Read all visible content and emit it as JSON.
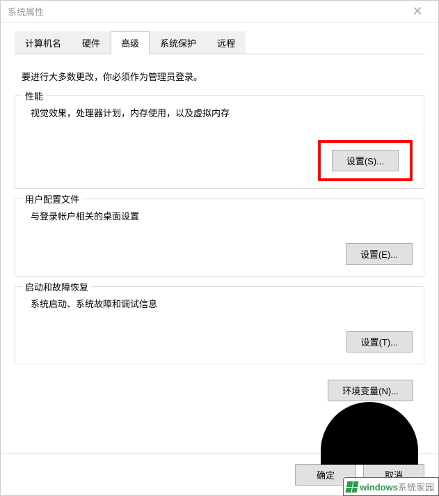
{
  "window": {
    "title": "系统属性"
  },
  "tabs": [
    {
      "label": "计算机名"
    },
    {
      "label": "硬件"
    },
    {
      "label": "高级"
    },
    {
      "label": "系统保护"
    },
    {
      "label": "远程"
    }
  ],
  "intro": "要进行大多数更改，你必须作为管理员登录。",
  "groups": {
    "performance": {
      "title": "性能",
      "desc": "视觉效果，处理器计划，内存使用，以及虚拟内存",
      "button": "设置(S)..."
    },
    "userProfile": {
      "title": "用户配置文件",
      "desc": "与登录帐户相关的桌面设置",
      "button": "设置(E)..."
    },
    "startupRecovery": {
      "title": "启动和故障恢复",
      "desc": "系统启动、系统故障和调试信息",
      "button": "设置(T)..."
    }
  },
  "envVarButton": "环境变量(N)...",
  "dialogButtons": {
    "ok": "确定",
    "cancel": "取消"
  },
  "watermark": {
    "text1": "windows",
    "text2": "系统家园"
  }
}
